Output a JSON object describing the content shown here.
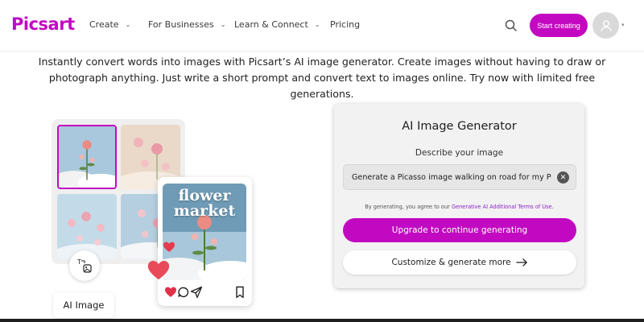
{
  "header": {
    "logo": "Picsart",
    "nav": [
      {
        "label": "Create"
      },
      {
        "label": "For Businesses"
      },
      {
        "label": "Learn & Connect"
      },
      {
        "label": "Pricing"
      }
    ],
    "cta_label": "Start creating",
    "search_icon": "search-icon",
    "avatar_icon": "user-icon"
  },
  "intro": {
    "text": "Instantly convert words into images with Picsart’s AI image generator. Create images without having to draw or photograph anything. Just write a short prompt and convert text to images online. Try now with limited free generations."
  },
  "illustration": {
    "post_title": "flower market",
    "label": "AI Image",
    "transform_icon": "text-to-image-icon",
    "post_icons": [
      "heart-icon",
      "comment-icon",
      "send-icon",
      "bookmark-icon"
    ]
  },
  "generator": {
    "title": "AI Image Generator",
    "subtitle": "Describe your image",
    "prompt_value": "Generate a Picasso image walking on road for my Pov",
    "terms_text": "By generating, you agree to our ",
    "terms_link": "Generative AI Additional Terms of Use.",
    "upgrade_label": "Upgrade to continue generating",
    "customize_label": "Customize & generate more"
  },
  "colors": {
    "brand": "#c209c1",
    "link": "#8d22c5",
    "panel_bg": "#f2f2f2"
  }
}
